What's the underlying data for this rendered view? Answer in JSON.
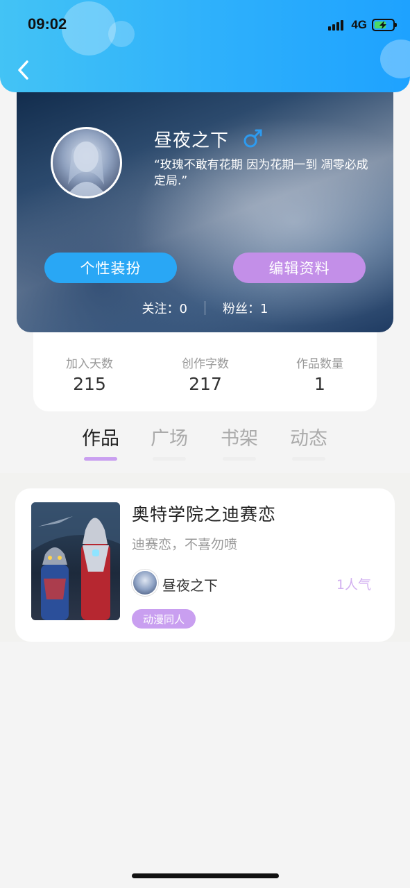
{
  "status_bar": {
    "time": "09:02",
    "network": "4G"
  },
  "profile": {
    "username": "昼夜之下",
    "signature": "“玫瑰不敢有花期 因为花期一到 凋零必成定局.”",
    "dress_up_label": "个性装扮",
    "edit_profile_label": "编辑资料",
    "following_label": "关注：",
    "following_count": "0",
    "fans_label": "粉丝：",
    "fans_count": "1",
    "gender_icon": "male-symbol",
    "colors": {
      "dress_button": "#29a7f5",
      "edit_button": "#c38fe8",
      "gender": "#2d9bf0"
    }
  },
  "stats": [
    {
      "label": "加入天数",
      "value": "215"
    },
    {
      "label": "创作字数",
      "value": "217"
    },
    {
      "label": "作品数量",
      "value": "1"
    }
  ],
  "tabs": [
    {
      "label": "作品",
      "active": true
    },
    {
      "label": "广场",
      "active": false
    },
    {
      "label": "书架",
      "active": false
    },
    {
      "label": "动态",
      "active": false
    }
  ],
  "works": [
    {
      "title": "奥特学院之迪赛恋",
      "description": "迪赛恋，不喜勿喷",
      "author": "昼夜之下",
      "popularity": "1人气",
      "tag": "动漫同人"
    }
  ],
  "accent": {
    "tab_active": "#c99ff0",
    "header_gradient": [
      "#43c3f5",
      "#1ea2ff"
    ]
  }
}
